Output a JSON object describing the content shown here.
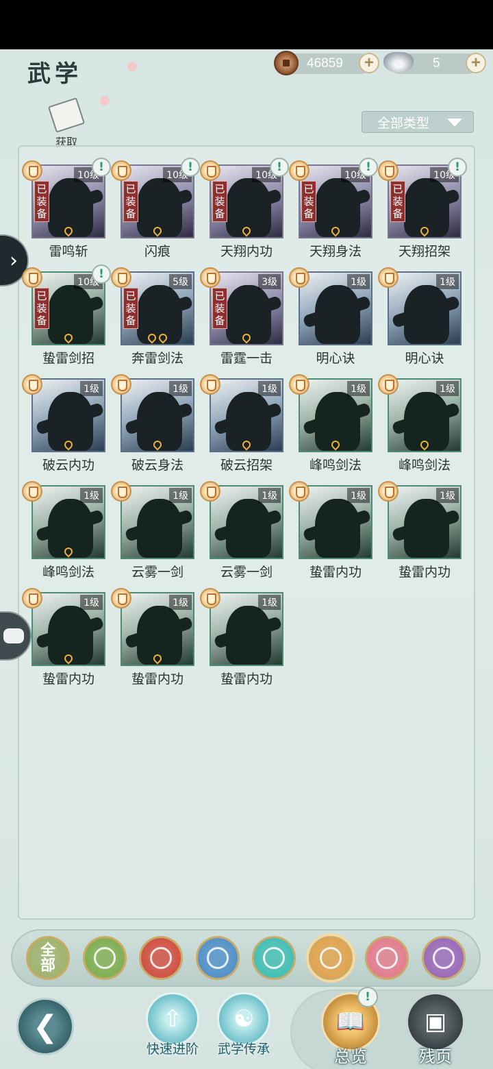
{
  "header": {
    "title": "武学",
    "copper_amount": "46859",
    "silver_amount": "5"
  },
  "acquire_label": "获取",
  "type_filter": "全部类型",
  "skills": [
    {
      "name": "雷鸣斩",
      "level": "10级",
      "equipped": true,
      "alert": true,
      "theme": "purple",
      "flames": 1
    },
    {
      "name": "闪痕",
      "level": "10级",
      "equipped": true,
      "alert": true,
      "theme": "purple",
      "flames": 1
    },
    {
      "name": "天翔内功",
      "level": "10级",
      "equipped": true,
      "alert": true,
      "theme": "purple",
      "flames": 1
    },
    {
      "name": "天翔身法",
      "level": "10级",
      "equipped": true,
      "alert": true,
      "theme": "purple",
      "flames": 1
    },
    {
      "name": "天翔招架",
      "level": "10级",
      "equipped": true,
      "alert": true,
      "theme": "purple",
      "flames": 1
    },
    {
      "name": "蛰雷剑招",
      "level": "10级",
      "equipped": true,
      "alert": true,
      "theme": "green",
      "flames": 1
    },
    {
      "name": "奔雷剑法",
      "level": "5级",
      "equipped": true,
      "alert": false,
      "theme": "blue",
      "flames": 2
    },
    {
      "name": "雷霆一击",
      "level": "3级",
      "equipped": true,
      "alert": false,
      "theme": "purple",
      "flames": 1
    },
    {
      "name": "明心诀",
      "level": "1级",
      "equipped": false,
      "alert": false,
      "theme": "blue",
      "flames": 0
    },
    {
      "name": "明心诀",
      "level": "1级",
      "equipped": false,
      "alert": false,
      "theme": "blue",
      "flames": 0
    },
    {
      "name": "破云内功",
      "level": "1级",
      "equipped": false,
      "alert": false,
      "theme": "blue",
      "flames": 1
    },
    {
      "name": "破云身法",
      "level": "1级",
      "equipped": false,
      "alert": false,
      "theme": "blue",
      "flames": 1
    },
    {
      "name": "破云招架",
      "level": "1级",
      "equipped": false,
      "alert": false,
      "theme": "blue",
      "flames": 1
    },
    {
      "name": "峰鸣剑法",
      "level": "1级",
      "equipped": false,
      "alert": false,
      "theme": "green",
      "flames": 1
    },
    {
      "name": "峰鸣剑法",
      "level": "1级",
      "equipped": false,
      "alert": false,
      "theme": "green",
      "flames": 1
    },
    {
      "name": "峰鸣剑法",
      "level": "1级",
      "equipped": false,
      "alert": false,
      "theme": "green",
      "flames": 1
    },
    {
      "name": "云雾一剑",
      "level": "1级",
      "equipped": false,
      "alert": false,
      "theme": "green",
      "flames": 0
    },
    {
      "name": "云雾一剑",
      "level": "1级",
      "equipped": false,
      "alert": false,
      "theme": "green",
      "flames": 0
    },
    {
      "name": "蛰雷内功",
      "level": "1级",
      "equipped": false,
      "alert": false,
      "theme": "green",
      "flames": 0
    },
    {
      "name": "蛰雷内功",
      "level": "1级",
      "equipped": false,
      "alert": false,
      "theme": "green",
      "flames": 0
    },
    {
      "name": "蛰雷内功",
      "level": "1级",
      "equipped": false,
      "alert": false,
      "theme": "green",
      "flames": 1
    },
    {
      "name": "蛰雷内功",
      "level": "1级",
      "equipped": false,
      "alert": false,
      "theme": "green",
      "flames": 1
    },
    {
      "name": "蛰雷内功",
      "level": "1级",
      "equipped": false,
      "alert": false,
      "theme": "green",
      "flames": 0
    }
  ],
  "equipped_tag": "已装备",
  "school_filters": [
    {
      "name": "all",
      "label": "全部",
      "color": "#9fb26a"
    },
    {
      "name": "sword",
      "color": "#7fae4e"
    },
    {
      "name": "flame",
      "color": "#d24c3e"
    },
    {
      "name": "wave",
      "color": "#4f8fc9"
    },
    {
      "name": "butterfly",
      "color": "#3fbfb5"
    },
    {
      "name": "shield",
      "color": "#e3a24a",
      "selected": true
    },
    {
      "name": "moon",
      "color": "#e57a8c"
    },
    {
      "name": "rose",
      "color": "#9b66b8"
    }
  ],
  "actions": {
    "quick_advance": "快速进阶",
    "martial_inherit": "武学传承",
    "overview": "总览",
    "fragments": "残页"
  }
}
